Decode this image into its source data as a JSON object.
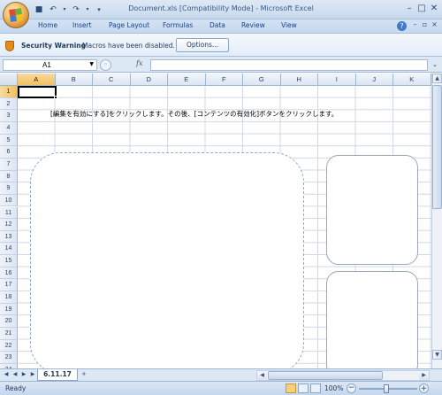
{
  "window": {
    "title": "Document.xls  [Compatibility Mode] - Microsoft Excel",
    "controls": [
      "minimize",
      "maximize",
      "close"
    ]
  },
  "ribbon": {
    "tabs": [
      "Home",
      "Insert",
      "Page Layout",
      "Formulas",
      "Data",
      "Review",
      "View"
    ],
    "help_icon": "help-icon"
  },
  "security_bar": {
    "title": "Security Warning",
    "message": "Macros have been disabled.",
    "options_label": "Options..."
  },
  "formula_bar": {
    "name_box": "A1",
    "fx_label": "fx",
    "formula": ""
  },
  "grid": {
    "columns": [
      "A",
      "B",
      "C",
      "D",
      "E",
      "F",
      "G",
      "H",
      "I",
      "J",
      "K"
    ],
    "rows": [
      "1",
      "2",
      "3",
      "4",
      "5",
      "6",
      "7",
      "8",
      "9",
      "10",
      "11",
      "12",
      "13",
      "14",
      "15",
      "16",
      "17",
      "18",
      "19",
      "20",
      "21",
      "22",
      "23",
      "24"
    ],
    "selected_column": "A",
    "selected_row": "1",
    "instruction_text": "[編集を有効にする]をクリックします。その後、[コンテンツの有効化]ボタンをクリックします。"
  },
  "sheets": {
    "active_tab": "6.11.17"
  },
  "status": {
    "ready": "Ready",
    "zoom": "100%"
  },
  "colors": {
    "accent": "#15428b",
    "selection_header": "#f1c15f",
    "gridline": "#d0d7e5"
  }
}
